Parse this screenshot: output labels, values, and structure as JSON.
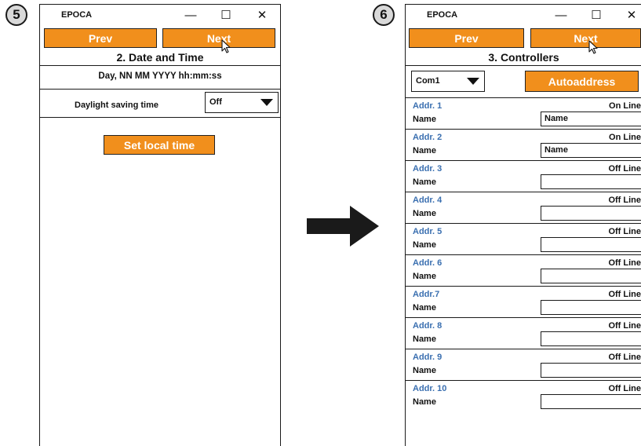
{
  "steps": [
    "5",
    "6"
  ],
  "left_window": {
    "title": "EPOCA",
    "controls": {
      "minimize": "—",
      "maximize": "☐",
      "close": "✕"
    },
    "prev_label": "Prev",
    "next_label": "Next",
    "section_title": "2. Date and Time",
    "datetime_format": "Day, NN MM YYYY  hh:mm:ss",
    "daylight_label": "Daylight saving time",
    "daylight_value": "Off",
    "set_time_label": "Set local time"
  },
  "right_window": {
    "title": "EPOCA",
    "controls": {
      "minimize": "—",
      "maximize": "☐",
      "close": "✕"
    },
    "prev_label": "Prev",
    "next_label": "Next",
    "section_title": "3. Controllers",
    "port_value": "Com1",
    "autoaddress_label": "Autoaddress",
    "name_label": "Name",
    "controllers": [
      {
        "addr": "Addr. 1",
        "status": "On Line",
        "name_value": "Name"
      },
      {
        "addr": "Addr. 2",
        "status": "On Line",
        "name_value": "Name"
      },
      {
        "addr": "Addr. 3",
        "status": "Off Line",
        "name_value": ""
      },
      {
        "addr": "Addr. 4",
        "status": "Off Line",
        "name_value": ""
      },
      {
        "addr": "Addr. 5",
        "status": "Off Line",
        "name_value": ""
      },
      {
        "addr": "Addr. 6",
        "status": "Off Line",
        "name_value": ""
      },
      {
        "addr": "Addr.7",
        "status": "Off Line",
        "name_value": ""
      },
      {
        "addr": "Addr. 8",
        "status": "Off Line",
        "name_value": ""
      },
      {
        "addr": "Addr. 9",
        "status": "Off Line",
        "name_value": ""
      },
      {
        "addr": "Addr. 10",
        "status": "Off Line",
        "name_value": ""
      }
    ]
  },
  "colors": {
    "accent": "#f18f1c",
    "address_blue": "#3a6fb0",
    "badge_gray": "#d9d9d9"
  },
  "icons": [
    "right-arrow-icon",
    "mouse-pointer-icon",
    "dropdown-triangle-icon"
  ]
}
